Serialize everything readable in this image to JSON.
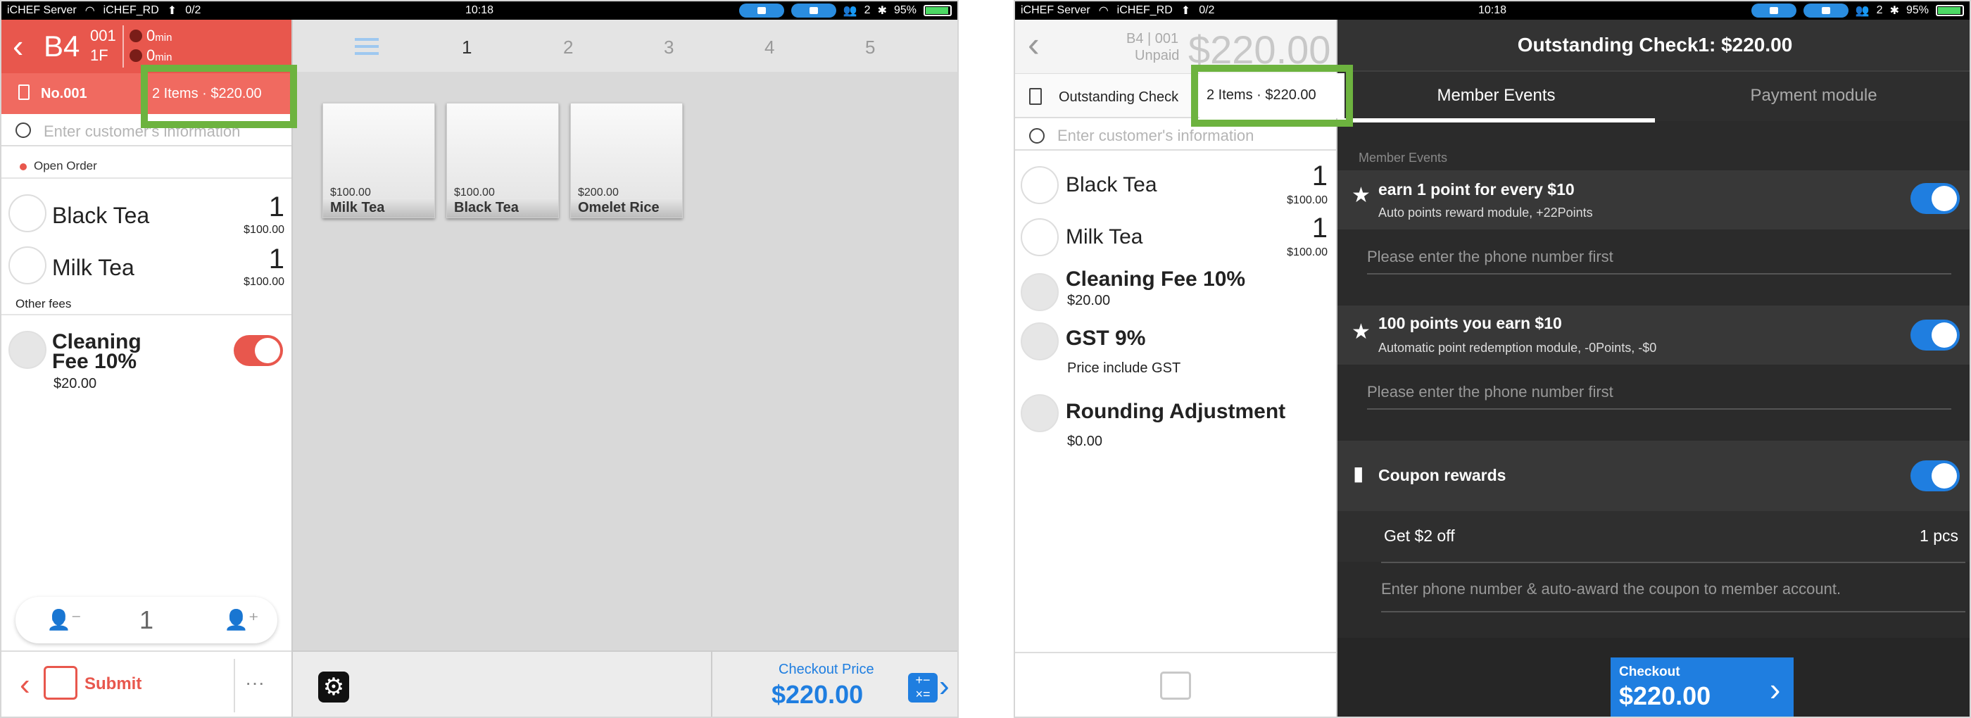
{
  "left": {
    "status": {
      "carrier": "iCHEF Server",
      "wifi": "iCHEF_RD",
      "counter": "0/2",
      "time": "10:18",
      "people": "2",
      "battery": "95%"
    },
    "header": {
      "table": "B4",
      "table_no": "001",
      "floor": "1F",
      "timer1_value": "0",
      "timer1_unit": "min",
      "timer2_value": "0",
      "timer2_unit": "min"
    },
    "order_bar": {
      "number": "No.001",
      "summary": "2 Items · $220.00"
    },
    "customer_placeholder": "Enter customer's information",
    "order_status": "Open Order",
    "items": [
      {
        "name": "Black Tea",
        "qty": "1",
        "price": "$100.00"
      },
      {
        "name": "Milk Tea",
        "qty": "1",
        "price": "$100.00"
      }
    ],
    "other_fees_label": "Other fees",
    "fees": [
      {
        "name": "Cleaning Fee 10%",
        "name_line1": "Cleaning",
        "name_line2": "Fee 10%",
        "amount": "$20.00"
      }
    ],
    "guest_count": "1",
    "submit_label": "Submit",
    "more_label": "···",
    "pages": [
      "1",
      "2",
      "3",
      "4",
      "5"
    ],
    "tiles": [
      {
        "price": "$100.00",
        "name": "Milk Tea"
      },
      {
        "price": "$100.00",
        "name": "Black Tea"
      },
      {
        "price": "$200.00",
        "name": "Omelet Rice"
      }
    ],
    "checkout": {
      "label": "Checkout Price",
      "amount": "$220.00"
    }
  },
  "right": {
    "status": {
      "carrier": "iCHEF Server",
      "wifi": "iCHEF_RD",
      "counter": "0/2",
      "time": "10:18",
      "people": "2",
      "battery": "95%"
    },
    "header": {
      "table": "B4 | 001",
      "state": "Unpaid",
      "amount": "$220.00",
      "title": "Outstanding Check1: $220.00"
    },
    "check_bar": {
      "label": "Outstanding Check",
      "summary": "2 Items · $220.00"
    },
    "customer_placeholder": "Enter customer's information",
    "items": [
      {
        "name": "Black Tea",
        "qty": "1",
        "price": "$100.00"
      },
      {
        "name": "Milk Tea",
        "qty": "1",
        "price": "$100.00"
      }
    ],
    "fees": [
      {
        "name": "Cleaning Fee 10%",
        "sub": "$20.00"
      },
      {
        "name": "GST 9%",
        "sub": "Price include GST"
      },
      {
        "name": "Rounding Adjustment",
        "sub": "$0.00"
      }
    ],
    "tabs": [
      "Member Events",
      "Payment module"
    ],
    "section_label": "Member Events",
    "events": [
      {
        "title": "earn 1 point for every $10",
        "sub": "Auto points reward module, +22Points",
        "phone_placeholder": "Please enter the phone number first"
      },
      {
        "title": "100 points you earn $10",
        "sub": "Automatic point redemption module, -0Points, -$0",
        "phone_placeholder": "Please enter the phone number first"
      }
    ],
    "coupon": {
      "title": "Coupon rewards",
      "item": "Get $2 off",
      "count": "1 pcs",
      "placeholder": "Enter phone number & auto-award the coupon to member account."
    },
    "checkout": {
      "label": "Checkout",
      "amount": "$220.00"
    }
  },
  "colors": {
    "accent_red": "#e8574d",
    "accent_blue": "#1f7ee0",
    "highlight_green": "#6db33f",
    "dark_panel": "#2b2b2b"
  }
}
